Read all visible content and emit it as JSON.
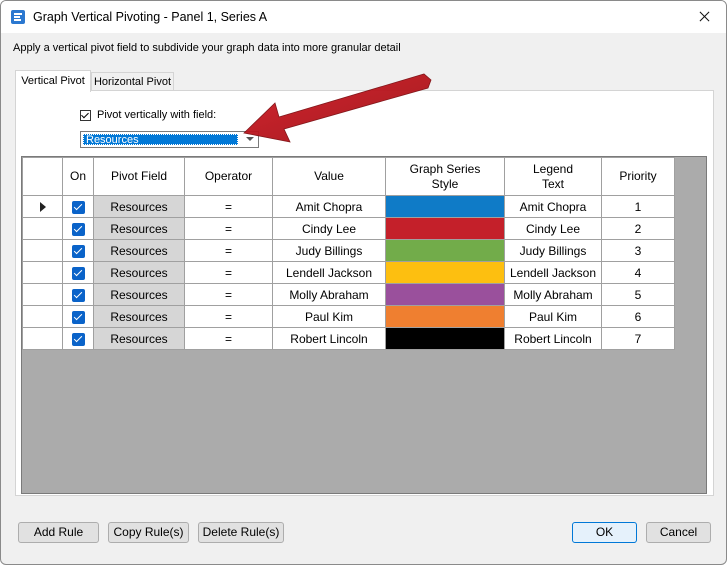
{
  "window": {
    "title": "Graph Vertical Pivoting - Panel 1, Series A"
  },
  "instructions": "Apply a vertical pivot field to subdivide your graph data into more granular detail",
  "tabs": [
    {
      "label": "Vertical Pivot",
      "active": true
    },
    {
      "label": "Horizontal Pivot",
      "active": false
    }
  ],
  "pivot": {
    "checkbox_label": "Pivot vertically with field:",
    "checked": true,
    "field_value": "Resources"
  },
  "table": {
    "columns": [
      "On",
      "Pivot Field",
      "Operator",
      "Value",
      "Graph Series Style",
      "Legend Text",
      "Priority"
    ],
    "rows": [
      {
        "on": true,
        "pivot_field": "Resources",
        "operator": "=",
        "value": "Amit Chopra",
        "color": "#0f7bc7",
        "legend": "Amit Chopra",
        "priority": "1"
      },
      {
        "on": true,
        "pivot_field": "Resources",
        "operator": "=",
        "value": "Cindy Lee",
        "color": "#c4202a",
        "legend": "Cindy Lee",
        "priority": "2"
      },
      {
        "on": true,
        "pivot_field": "Resources",
        "operator": "=",
        "value": "Judy Billings",
        "color": "#72ac4a",
        "legend": "Judy Billings",
        "priority": "3"
      },
      {
        "on": true,
        "pivot_field": "Resources",
        "operator": "=",
        "value": "Lendell Jackson",
        "color": "#fdbf10",
        "legend": "Lendell Jackson",
        "priority": "4"
      },
      {
        "on": true,
        "pivot_field": "Resources",
        "operator": "=",
        "value": "Molly Abraham",
        "color": "#9a509c",
        "legend": "Molly Abraham",
        "priority": "5"
      },
      {
        "on": true,
        "pivot_field": "Resources",
        "operator": "=",
        "value": "Paul Kim",
        "color": "#ef7f30",
        "legend": "Paul Kim",
        "priority": "6"
      },
      {
        "on": true,
        "pivot_field": "Resources",
        "operator": "=",
        "value": "Robert Lincoln",
        "color": "#000000",
        "legend": "Robert Lincoln",
        "priority": "7"
      }
    ]
  },
  "buttons": {
    "add_rule": "Add Rule",
    "copy_rules": "Copy Rule(s)",
    "delete_rules": "Delete Rule(s)",
    "ok": "OK",
    "cancel": "Cancel"
  },
  "colors": {
    "accent": "#0078d7",
    "annotation_arrow": "#c0181f"
  },
  "icons": {
    "app": "app-icon",
    "close": "close-icon",
    "row_pointer": "row-pointer-icon",
    "dropdown": "chevron-down-icon"
  }
}
